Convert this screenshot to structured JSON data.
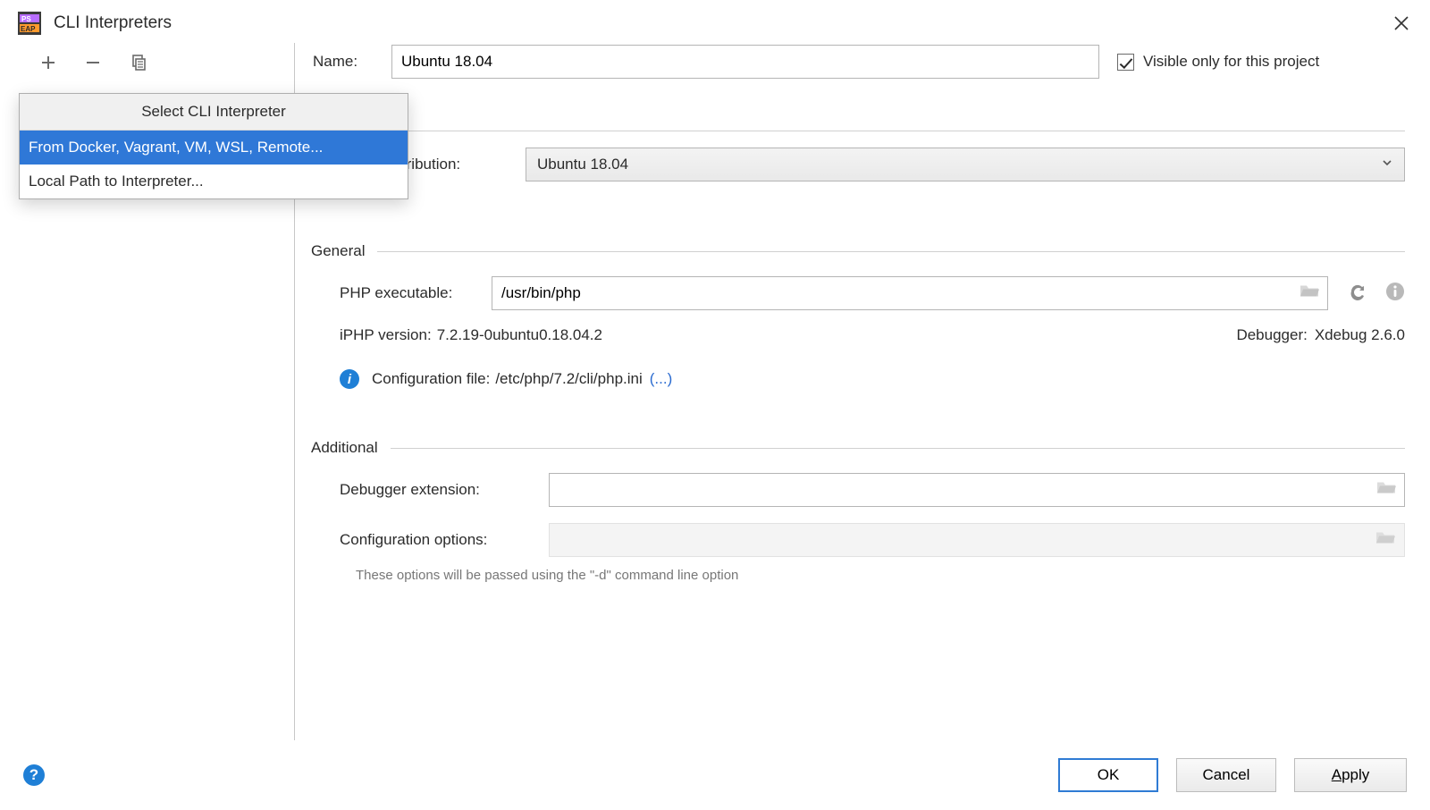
{
  "window": {
    "title": "CLI Interpreters"
  },
  "popup": {
    "title": "Select CLI Interpreter",
    "items": [
      "From Docker, Vagrant, VM, WSL, Remote...",
      "Local Path to Interpreter..."
    ],
    "selected_index": 0
  },
  "form": {
    "name_label": "Name:",
    "name_value": "Ubuntu 18.04",
    "visible_only_label": "Visible only for this project",
    "visible_only_checked": true,
    "linux_dist_label": "Linux Distribution:",
    "linux_dist_value": "Ubuntu 18.04"
  },
  "general": {
    "section_label": "General",
    "php_exec_label": "PHP executable:",
    "php_exec_value": "/usr/bin/php",
    "php_version_label": "PHP version:",
    "php_version_value": "7.2.19-0ubuntu0.18.04.2",
    "debugger_label": "Debugger:",
    "debugger_value": "Xdebug 2.6.0",
    "config_file_label": "Configuration file:",
    "config_file_value": "/etc/php/7.2/cli/php.ini",
    "config_file_more": "(...)"
  },
  "additional": {
    "section_label": "Additional",
    "debugger_ext_label": "Debugger extension:",
    "debugger_ext_value": "",
    "config_opts_label": "Configuration options:",
    "config_opts_value": "",
    "hint": "These options will be passed using the \"-d\" command line option"
  },
  "buttons": {
    "ok": "OK",
    "cancel": "Cancel",
    "apply": "Apply"
  }
}
